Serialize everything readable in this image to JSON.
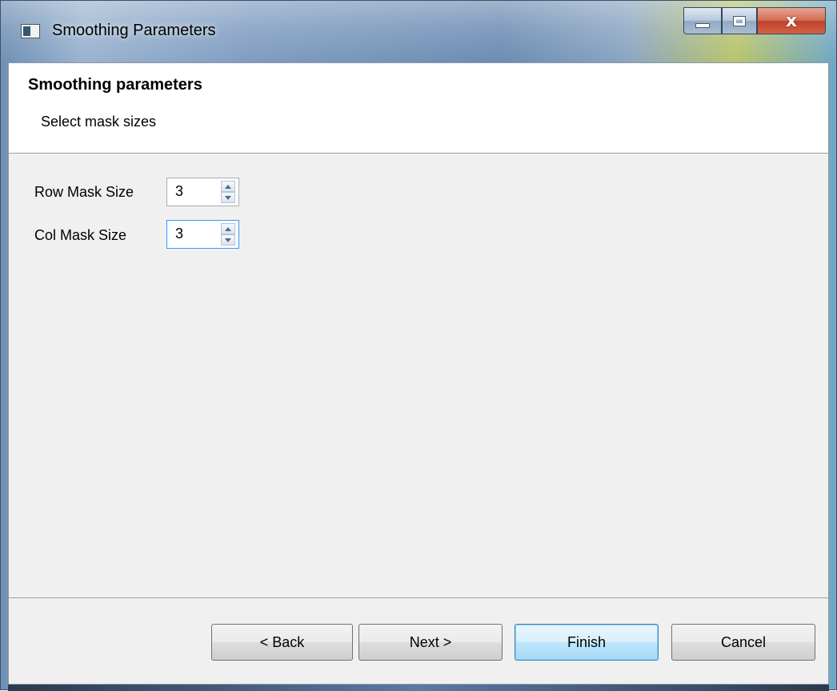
{
  "window": {
    "title": "Smoothing Parameters",
    "controls": {
      "minimize": "minimize",
      "maximize": "maximize",
      "close": "x"
    }
  },
  "header": {
    "title": "Smoothing parameters",
    "description": "Select mask sizes"
  },
  "fields": [
    {
      "label": "Row Mask Size",
      "value": "3"
    },
    {
      "label": "Col Mask Size",
      "value": "3"
    }
  ],
  "buttons": {
    "back": "< Back",
    "next": "Next >",
    "finish": "Finish",
    "cancel": "Cancel"
  },
  "colors": {
    "client_bg": "#f0f0f0",
    "header_bg": "#ffffff",
    "default_button_border": "#3c7fb1",
    "focus_border": "#3399ff"
  }
}
